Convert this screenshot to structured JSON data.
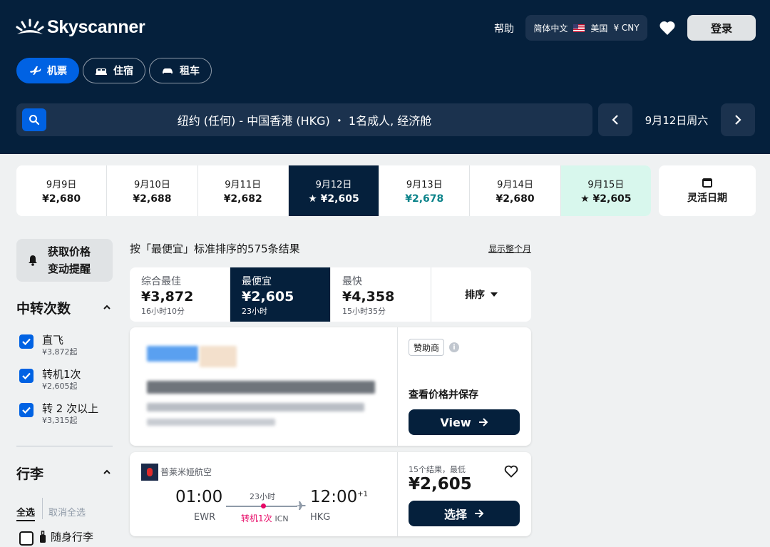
{
  "header": {
    "logo_text": "Skyscanner",
    "help": "帮助",
    "locale": {
      "language": "简体中文",
      "region": "美国",
      "currency": "¥ CNY"
    },
    "login": "登录"
  },
  "nav_pills": [
    {
      "label": "机票",
      "icon": "plane-icon",
      "active": true
    },
    {
      "label": "住宿",
      "icon": "bed-icon",
      "active": false
    },
    {
      "label": "租车",
      "icon": "car-icon",
      "active": false
    }
  ],
  "search": {
    "summary": "纽约 (任何) - 中国香港 (HKG) ・ 1名成人, 经济舱",
    "current_date": "9月12日周六"
  },
  "date_strip": [
    {
      "date": "9月9日",
      "price": "¥2,680"
    },
    {
      "date": "9月10日",
      "price": "¥2,688"
    },
    {
      "date": "9月11日",
      "price": "¥2,682"
    },
    {
      "date": "9月12日",
      "price": "★ ¥2,605",
      "selected": true
    },
    {
      "date": "9月13日",
      "price": "¥2,678",
      "green": true
    },
    {
      "date": "9月14日",
      "price": "¥2,680"
    },
    {
      "date": "9月15日",
      "price": "★ ¥2,605",
      "mint": true
    }
  ],
  "flexible_dates": "灵活日期",
  "sidebar": {
    "alert_line1": "获取价格",
    "alert_line2": "变动提醒",
    "stops_title": "中转次数",
    "stops": [
      {
        "label": "直飞",
        "sub": "¥3,872起",
        "checked": true
      },
      {
        "label": "转机1次",
        "sub": "¥2,605起",
        "checked": true
      },
      {
        "label": "转 2 次以上",
        "sub": "¥3,315起",
        "checked": true
      }
    ],
    "baggage_title": "行李",
    "select_all": "全选",
    "deselect_all": "取消全选",
    "carry_on": "随身行李"
  },
  "results": {
    "title": "按「最便宜」标准排序的575条结果",
    "show_month": "显示整个月",
    "sort_tabs": [
      {
        "label": "综合最佳",
        "price": "¥3,872",
        "duration": "16小时10分"
      },
      {
        "label": "最便宜",
        "price": "¥2,605",
        "duration": "23小时",
        "active": true
      },
      {
        "label": "最快",
        "price": "¥4,358",
        "duration": "15小时35分"
      }
    ],
    "sort_label": "排序"
  },
  "sponsored": {
    "tag": "赞助商",
    "info": "i",
    "cta_text": "查看价格并保存",
    "button": "View"
  },
  "flight": {
    "airline": "普莱米娅航空",
    "depart_time": "01:00",
    "depart_airport": "EWR",
    "arrive_time": "12:00",
    "arrive_offset": "+1",
    "arrive_airport": "HKG",
    "duration": "23小时",
    "stops": "转机1次",
    "stop_airport": "ICN",
    "count_text": "15个结果，最低",
    "price": "¥2,605",
    "select": "选择"
  },
  "colors": {
    "navy": "#05203c",
    "blue": "#0062e3",
    "pink": "#e70866",
    "teal": "#0c838a",
    "mint": "#d8f7ed"
  }
}
